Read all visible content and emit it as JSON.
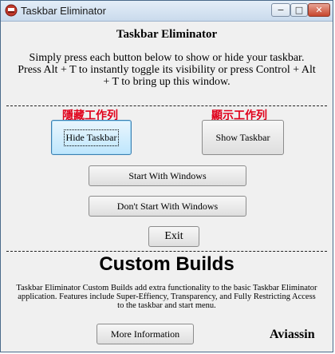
{
  "window": {
    "title": "Taskbar Eliminator",
    "controls": {
      "minimize": "−",
      "maximize": "□",
      "close": "✕"
    }
  },
  "main": {
    "heading": "Taskbar Eliminator",
    "instructions_line1": "Simply press each button below to show or hide your taskbar.",
    "instructions_line2": "Press Alt + T to instantly toggle its visibility or press Control + Alt",
    "instructions_line3": "+ T to bring up this window.",
    "hide_label_cjk": "隱藏工作列",
    "show_label_cjk": "顯示工作列",
    "hide_button": "Hide Taskbar",
    "show_button": "Show Taskbar",
    "start_with_windows": "Start With Windows",
    "dont_start_with_windows": "Don't Start With Windows",
    "exit_button": "Exit"
  },
  "custom": {
    "heading": "Custom Builds",
    "desc_line1": "Taskbar Eliminator Custom Builds add extra functionality to the basic Taskbar Eliminator",
    "desc_line2": "application. Features include Super-Effiency, Transparency, and Fully Restricting Access",
    "desc_line3": "to the taskbar and start menu.",
    "more_info_button": "More Information",
    "author": "Aviassin"
  },
  "colors": {
    "accent_red": "#e0001b"
  }
}
